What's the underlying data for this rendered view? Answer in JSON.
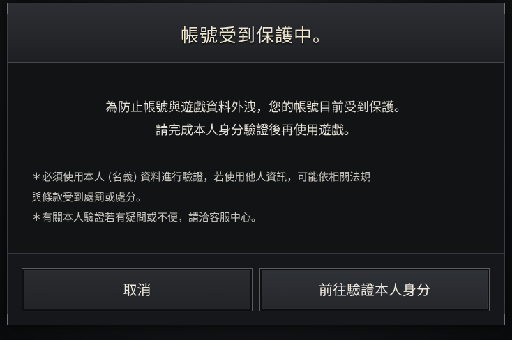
{
  "dialog": {
    "title": "帳號受到保護中。",
    "message_line1": "為防止帳號與遊戲資料外洩，您的帳號目前受到保護。",
    "message_line2": "請完成本人身分驗證後再使用遊戲。",
    "note_line1": "＊必須使用本人 (名義) 資料進行驗證，若使用他人資訊，可能依相關法規",
    "note_line2": "與條款受到處罰或處分。",
    "note_line3": "＊有關本人驗證若有疑問或不便，請洽客服中心。"
  },
  "buttons": {
    "cancel_label": "取消",
    "confirm_label": "前往驗證本人身分"
  },
  "colors": {
    "title_text": "#efe6cf",
    "body_text": "#e6e3da",
    "dialog_background": "#131416"
  }
}
